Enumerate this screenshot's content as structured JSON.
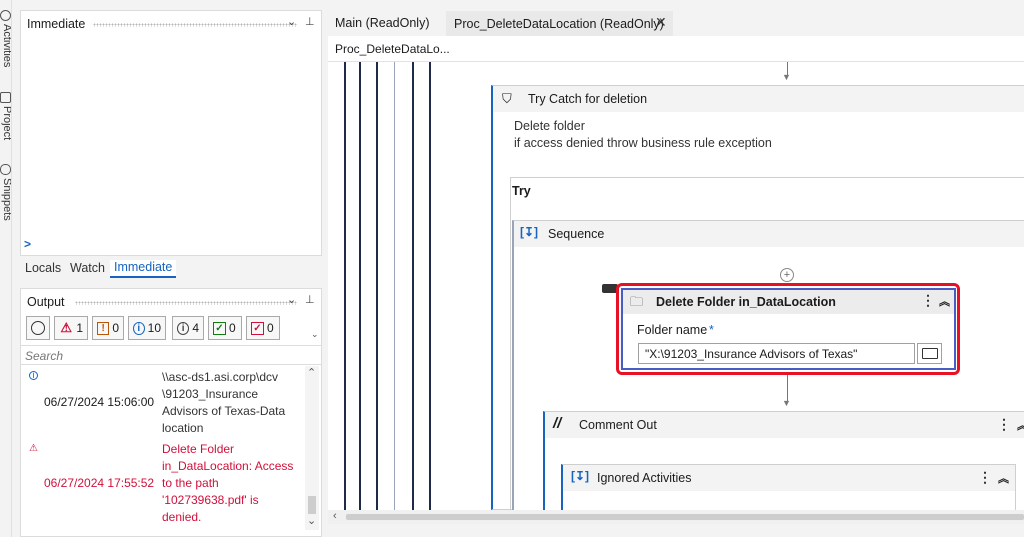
{
  "left_strip": {
    "tabs": [
      "Activities",
      "Project",
      "Snippets"
    ]
  },
  "immediate_panel": {
    "title": "Immediate",
    "prompt_symbol": ">",
    "tabs": [
      "Locals",
      "Watch",
      "Immediate"
    ]
  },
  "output_panel": {
    "title": "Output",
    "filters": [
      {
        "icon": "clock-icon",
        "count": ""
      },
      {
        "icon": "error-icon",
        "count": "1"
      },
      {
        "icon": "warning-icon",
        "count": "0"
      },
      {
        "icon": "info-icon",
        "count": "10"
      },
      {
        "icon": "trace-icon",
        "count": "4"
      },
      {
        "icon": "success-icon",
        "count": "0"
      },
      {
        "icon": "check-red-icon",
        "count": "0"
      }
    ],
    "search_placeholder": "Search",
    "logs": [
      {
        "type": "info",
        "timestamp": "06/27/2024 15:06:00",
        "lines": [
          "\\\\asc-ds1.asi.corp\\dcv",
          "\\91203_Insurance",
          "Advisors of Texas-Data",
          "location"
        ]
      },
      {
        "type": "error",
        "timestamp": "06/27/2024 17:55:52",
        "lines": [
          "Delete Folder",
          "in_DataLocation: Access",
          "to the path",
          "'102739638.pdf' is",
          "denied."
        ]
      }
    ]
  },
  "editor": {
    "tabs": [
      {
        "label": "Main (ReadOnly)",
        "active": false
      },
      {
        "label": "Proc_DeleteDataLocation (ReadOnly)",
        "active": true
      }
    ],
    "breadcrumb": "Proc_DeleteDataLo...",
    "try_catch": {
      "title": "Try Catch for deletion",
      "annotation_1": "Delete folder",
      "annotation_2": "if access denied throw business rule exception",
      "try_label": "Try"
    },
    "sequence": {
      "title": "Sequence"
    },
    "delete_folder": {
      "title": "Delete Folder in_DataLocation",
      "field_label": "Folder name",
      "required_mark": "*",
      "field_value": "\"X:\\91203_Insurance Advisors of Texas\""
    },
    "comment_out": {
      "title": "Comment Out"
    },
    "ignored": {
      "title": "Ignored Activities"
    }
  },
  "colors": {
    "accent": "#1664c0",
    "error": "#d0103a",
    "selection": "#e81123"
  }
}
